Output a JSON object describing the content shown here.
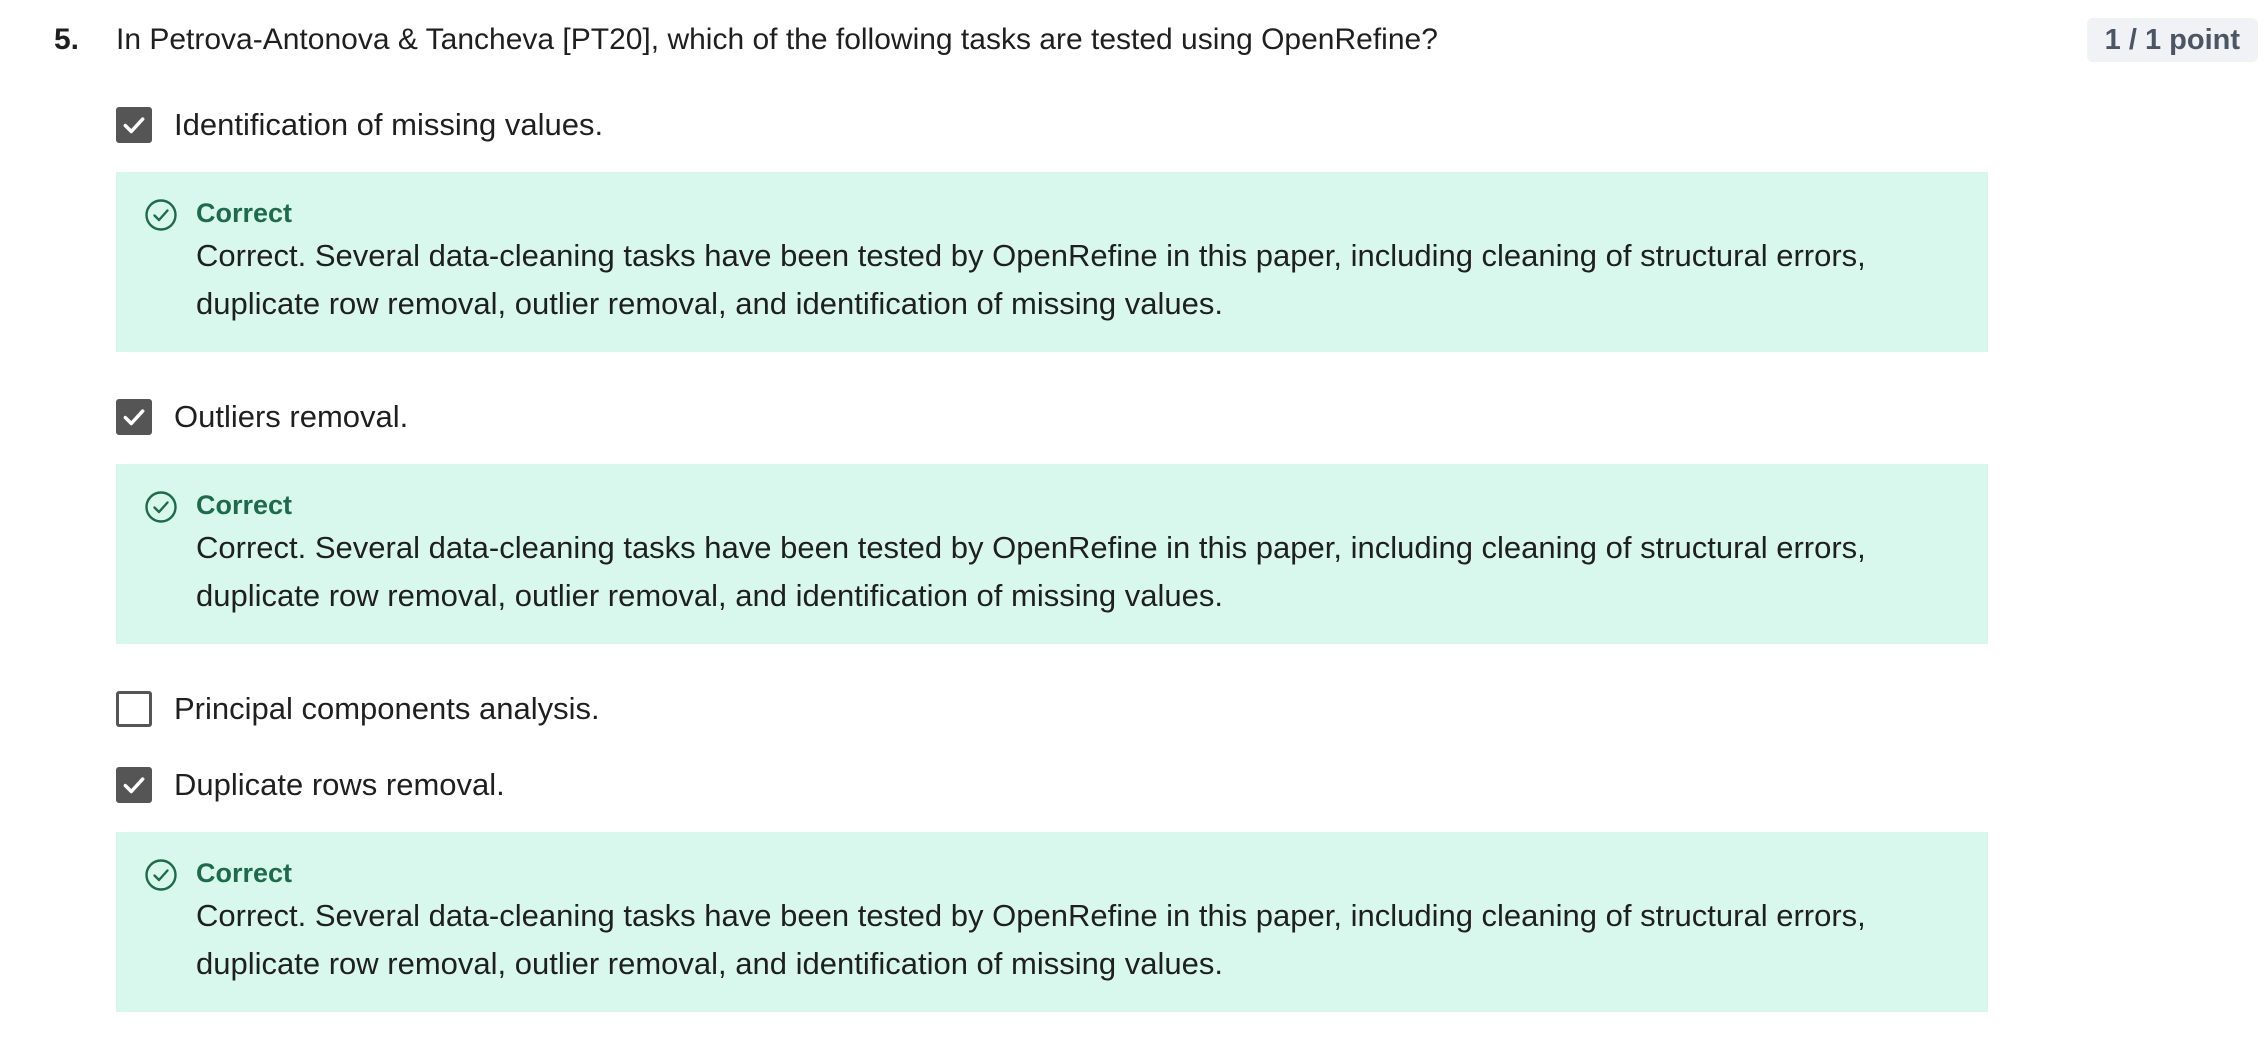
{
  "question": {
    "number": "5.",
    "text": "In Petrova-Antonova & Tancheva [PT20], which of the following tasks are tested using OpenRefine?",
    "points": "1 / 1 point"
  },
  "options": [
    {
      "label": "Identification of missing values.",
      "checked": true,
      "feedback": {
        "title": "Correct",
        "text": "Correct. Several data-cleaning tasks have been tested by OpenRefine in this paper, including cleaning of structural errors, duplicate row removal, outlier removal, and identification of missing values."
      }
    },
    {
      "label": "Outliers removal.",
      "checked": true,
      "feedback": {
        "title": "Correct",
        "text": "Correct. Several data-cleaning tasks have been tested by OpenRefine in this paper, including cleaning of structural errors, duplicate row removal, outlier removal, and identification of missing values."
      }
    },
    {
      "label": "Principal components analysis.",
      "checked": false
    },
    {
      "label": "Duplicate rows removal.",
      "checked": true,
      "feedback": {
        "title": "Correct",
        "text": "Correct. Several data-cleaning tasks have been tested by OpenRefine in this paper, including cleaning of structural errors, duplicate row removal, outlier removal, and identification of missing values."
      }
    }
  ],
  "colors": {
    "feedback_background": "#d8f8ee",
    "feedback_accent": "#1e6b4b",
    "checkbox_fill": "#555555",
    "badge_background": "#f0f2f6"
  },
  "icons": {
    "checkbox_checked": "checkmark-icon",
    "feedback": "check-circle-icon"
  }
}
